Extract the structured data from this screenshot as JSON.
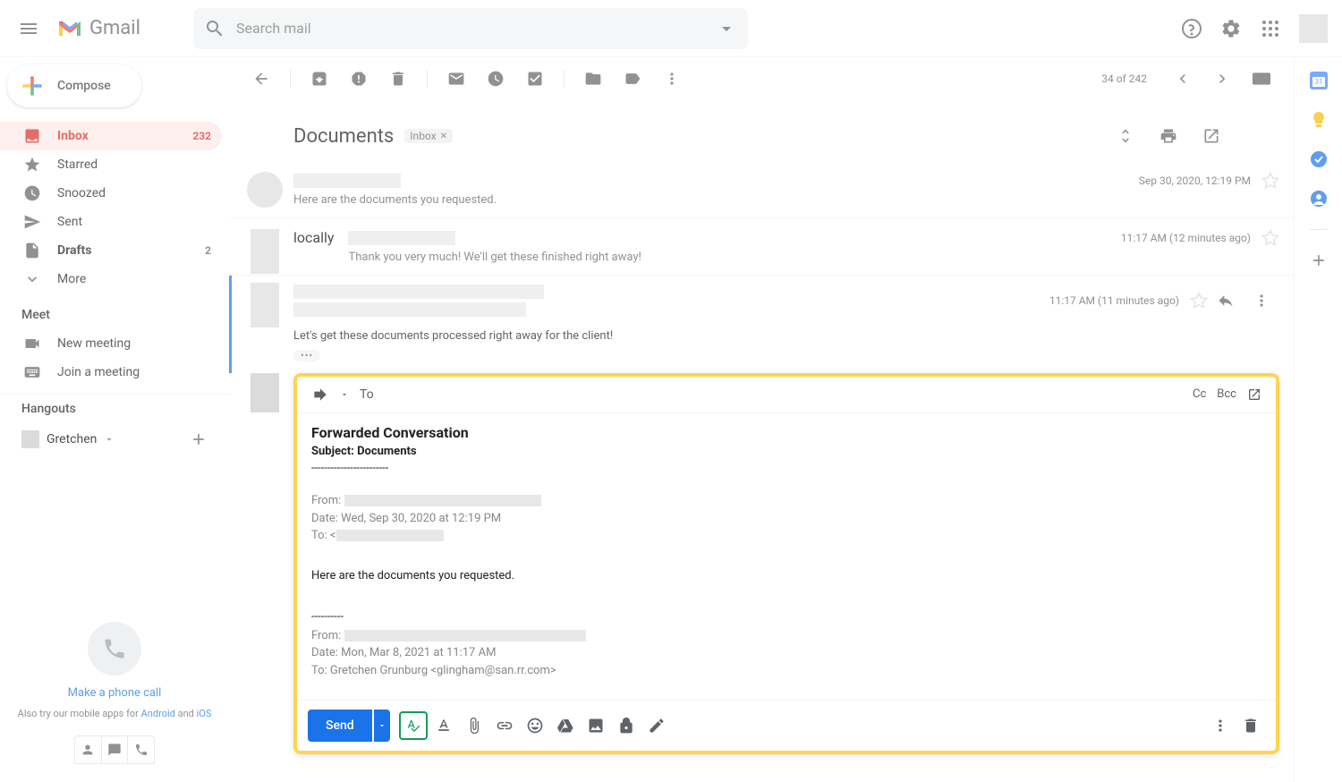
{
  "header": {
    "logo_text": "Gmail",
    "search_placeholder": "Search mail"
  },
  "sidebar": {
    "compose_label": "Compose",
    "items": [
      {
        "label": "Inbox",
        "count": "232"
      },
      {
        "label": "Starred",
        "count": ""
      },
      {
        "label": "Snoozed",
        "count": ""
      },
      {
        "label": "Sent",
        "count": ""
      },
      {
        "label": "Drafts",
        "count": "2"
      },
      {
        "label": "More",
        "count": ""
      }
    ],
    "meet_title": "Meet",
    "meet_items": [
      {
        "label": "New meeting"
      },
      {
        "label": "Join a meeting"
      }
    ],
    "hangouts_title": "Hangouts",
    "hangouts_user": "Gretchen",
    "phone_link": "Make a phone call",
    "mobile_pre": "Also try our mobile apps for ",
    "mobile_android": "Android",
    "mobile_and": " and ",
    "mobile_ios": "iOS"
  },
  "toolbar": {
    "page_count": "34 of 242"
  },
  "thread": {
    "title": "Documents",
    "tag": "Inbox",
    "messages": [
      {
        "snippet": "Here are the documents you requested.",
        "time": "Sep 30, 2020, 12:19 PM"
      },
      {
        "snippet": "Thank you very much! We'll get these finished right away!",
        "time": "11:17 AM (12 minutes ago)"
      },
      {
        "snippet": "Let's get these documents processed right away for the client!",
        "time": "11:17 AM (11 minutes ago)"
      }
    ]
  },
  "compose": {
    "to_label": "To",
    "cc_label": "Cc",
    "bcc_label": "Bcc",
    "fwd_title": "Forwarded Conversation",
    "subject_label": "Subject: Documents",
    "sep_long": "------------------------",
    "sep_short": "----------",
    "msg1_from_label": "From: ",
    "msg1_date": "Date: Wed, Sep 30, 2020 at 12:19 PM",
    "msg1_to_label": "To: <",
    "msg1_body": "Here are the documents you requested.",
    "msg2_from_label": "From: ",
    "msg2_date": "Date: Mon, Mar 8, 2021 at 11:17 AM",
    "msg2_to": "To: Gretchen Grunburg <glingham@san.rr.com>",
    "msg2_body": "Thank you very much! We'll get these finished right away!",
    "send_label": "Send"
  }
}
